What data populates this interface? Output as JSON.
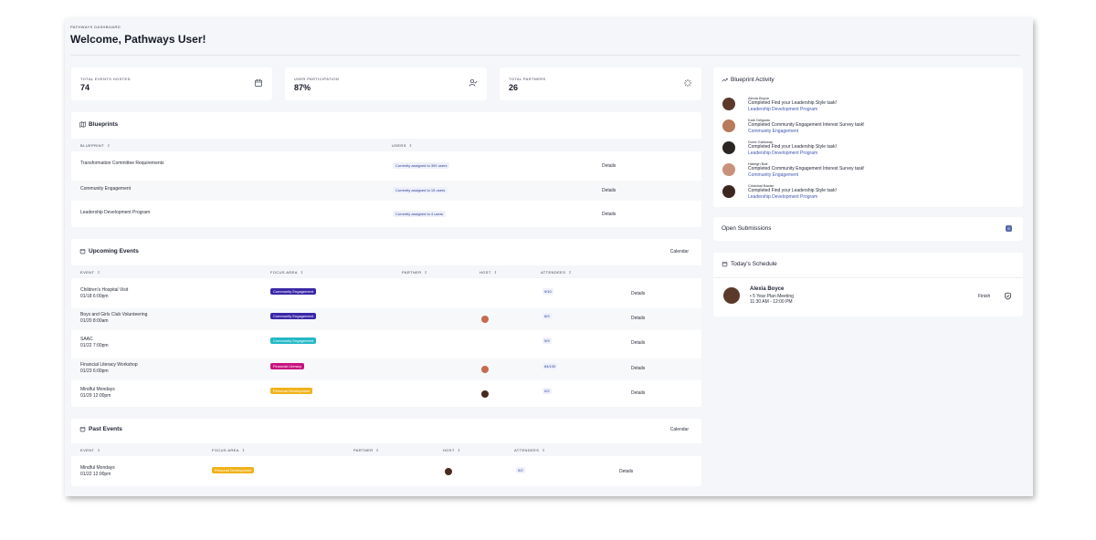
{
  "header": {
    "breadcrumb": "PATHWAYS DASHBOARD",
    "title": "Welcome, Pathways User!"
  },
  "stats": [
    {
      "label": "TOTAL EVENTS HOSTED",
      "value": "74",
      "icon": "calendar-icon"
    },
    {
      "label": "USER PARTICIPATION",
      "value": "87%",
      "icon": "user-check-icon"
    },
    {
      "label": "TOTAL PARTNERS",
      "value": "26",
      "icon": "loader-icon"
    }
  ],
  "blueprints": {
    "title": "Blueprints",
    "columns": {
      "blueprint": "BLUEPRINT",
      "users": "USERS"
    },
    "rows": [
      {
        "name": "Transformation Committee Requirements",
        "users": "Currently assigned to 390 users",
        "action": "Details"
      },
      {
        "name": "Community Engagement",
        "users": "Currently assigned to 15 users",
        "action": "Details"
      },
      {
        "name": "Leadership Development Program",
        "users": "Currently assigned to 4 users",
        "action": "Details"
      }
    ]
  },
  "upcoming": {
    "title": "Upcoming Events",
    "calendar_label": "Calendar",
    "columns": {
      "event": "EVENT",
      "focus": "FOCUS AREA",
      "partner": "PARTNER",
      "host": "HOST",
      "attendees": "ATTENDEES"
    },
    "rows": [
      {
        "name": "Children's Hospital Visit",
        "date": "01/18 6:00pm",
        "focus": "Community Engagement",
        "focus_color": "#3a27a8",
        "attendees": "9/10",
        "action": "Details",
        "host_color": ""
      },
      {
        "name": "Boys and Girls Club Volunteering",
        "date": "01/20 8:00am",
        "focus": "Community Engagement",
        "focus_color": "#3a27a8",
        "attendees": "8/9",
        "action": "Details",
        "host_color": "#c56b52"
      },
      {
        "name": "SAAC",
        "date": "01/22 7:00pm",
        "focus": "Community Engagement",
        "focus_color": "#22b8c6",
        "attendees": "5/9",
        "action": "Details",
        "host_color": ""
      },
      {
        "name": "Financial Literacy Workshop",
        "date": "01/23 6:00pm",
        "focus": "Financial Literacy",
        "focus_color": "#c8137e",
        "attendees": "84/100",
        "action": "Details",
        "host_color": "#c56b52"
      },
      {
        "name": "Mindful Mondays",
        "date": "01/29 12:00pm",
        "focus": "Personal Development",
        "focus_color": "#f0b21a",
        "attendees": "0/2",
        "action": "Details",
        "host_color": "#4a2a1f"
      }
    ]
  },
  "past": {
    "title": "Past Events",
    "calendar_label": "Calendar",
    "columns": {
      "event": "EVENT",
      "focus": "FOCUS AREA",
      "partner": "PARTNER",
      "host": "HOST",
      "attendees": "ATTENDEES"
    },
    "rows": [
      {
        "name": "Mindful Mondays",
        "date": "01/22 12:00pm",
        "focus": "Personal Development",
        "focus_color": "#f0b21a",
        "attendees": "0/2",
        "action": "Details",
        "host_color": "#4a2a1f"
      }
    ]
  },
  "activity": {
    "title": "Blueprint Activity",
    "items": [
      {
        "name": "Alexia Boyce",
        "text": "Completed Find your Leadership Style task!",
        "program": "Leadership Development Program",
        "avatar_color": "#5b3a2c"
      },
      {
        "name": "Kale Delgado",
        "text": "Completed Community Engagement Interest Survey task!",
        "program": "Community Engagement",
        "avatar_color": "#b77a5a"
      },
      {
        "name": "Dorie Galloway",
        "text": "Completed Find your Leadership Style task!",
        "program": "Leadership Development Program",
        "avatar_color": "#2b2623"
      },
      {
        "name": "Haleigh Ball",
        "text": "Completed Community Engagement Interest Survey task!",
        "program": "Community Engagement",
        "avatar_color": "#c8927a"
      },
      {
        "name": "Cristobal Baxter",
        "text": "Completed Find your Leadership Style task!",
        "program": "Leadership Development Program",
        "avatar_color": "#3b2720"
      }
    ]
  },
  "submissions": {
    "title": "Open Submissions",
    "count": "5"
  },
  "schedule": {
    "title": "Today's Schedule",
    "person": "Alexia Boyce",
    "meeting": "• 5 Year Plan Meeting",
    "time": "11:30 AM - 12:00 PM",
    "action": "Finish",
    "avatar_color": "#5b3a2c"
  }
}
